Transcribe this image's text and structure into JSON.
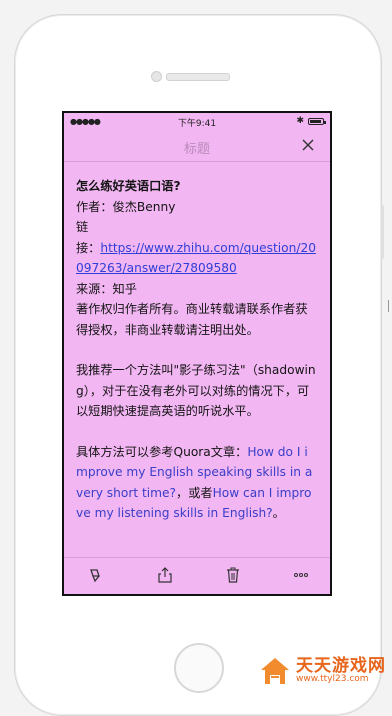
{
  "statusbar": {
    "signal": "●●●●●",
    "time": "下午9:41",
    "bluetooth": "✱",
    "battery_icon": "battery-icon"
  },
  "navbar": {
    "title": "标题",
    "close_icon": "close-icon"
  },
  "article": {
    "title": "怎么练好英语口语?",
    "author": "作者：俊杰Benny",
    "link_prefix_1": "链",
    "link_prefix_2": "接：",
    "link_url": "https://www.zhihu.com/question/20097263/answer/27809580",
    "source": "来源：知乎",
    "copyright": "著作权归作者所有。商业转载请联系作者获得授权，非商业转载请注明出处。",
    "para1": "我推荐一个方法叫\"影子练习法\"（shadowing），对于在没有老外可以对练的情况下，可以短期快速提高英语的听说水平。",
    "para2_prefix": "具体方法可以参考Quora文章：",
    "para2_link1": "How do I improve my English speaking skills in a very short time?",
    "para2_mid": "，或者",
    "para2_link2": "How can I improve my listening skills in English?",
    "para2_suffix": "。"
  },
  "toolbar": {
    "icons": [
      "brush-icon",
      "share-icon",
      "trash-icon",
      "more-icon"
    ]
  },
  "watermark": {
    "title": "天天游戏网",
    "url": "www.ttyl23.com"
  },
  "colors": {
    "screen_bg": "#f2b6f2",
    "link": "#2f3fd8",
    "watermark": "#e8651c"
  }
}
